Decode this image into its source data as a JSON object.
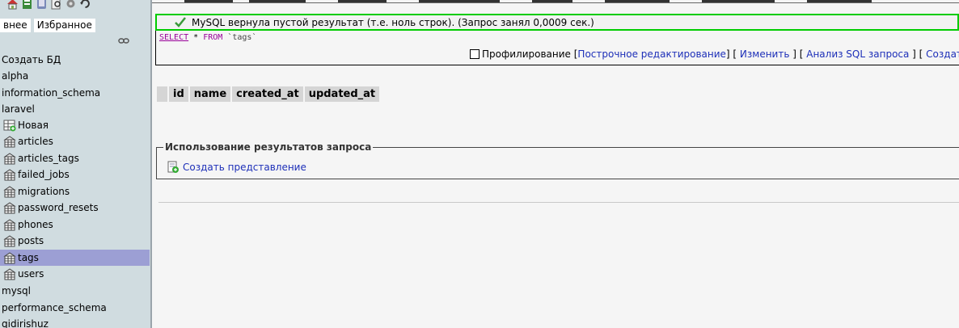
{
  "sidebar": {
    "nav_icons": [
      "home-icon",
      "exit-icon",
      "sql-query-icon",
      "docs-icon",
      "settings-icon",
      "reload-icon"
    ],
    "tabs": [
      "внее",
      "Избранное"
    ],
    "create_db": "Создать БД",
    "databases_top": [
      "alpha",
      "information_schema",
      "laravel"
    ],
    "new_table": "Новая",
    "tables": [
      "articles",
      "articles_tags",
      "failed_jobs",
      "migrations",
      "password_resets",
      "phones",
      "posts",
      "tags",
      "users"
    ],
    "active_table": "tags",
    "databases_bottom": [
      "mysql",
      "performance_schema",
      "qidirishuz"
    ],
    "active_color": "#9c9fd4"
  },
  "message": {
    "text": "MySQL вернула пустой результат (т.е. ноль строк). (Запрос занял 0,0009 сек.)",
    "border_color": "#00cc00"
  },
  "sql": {
    "select": "SELECT",
    "star": "*",
    "from": "FROM",
    "table": "`tags`"
  },
  "actions": {
    "profiling": "Профилирование",
    "inline_edit": "Построчное редактирование",
    "edit": "Изменить",
    "analyze": "Анализ SQL запроса",
    "create_php": "Создать PH"
  },
  "result_table": {
    "columns": [
      "id",
      "name",
      "created_at",
      "updated_at"
    ]
  },
  "query_usage": {
    "legend": "Использование результатов запроса",
    "create_view": "Создать представление"
  },
  "link_color": "#1d2fb8"
}
